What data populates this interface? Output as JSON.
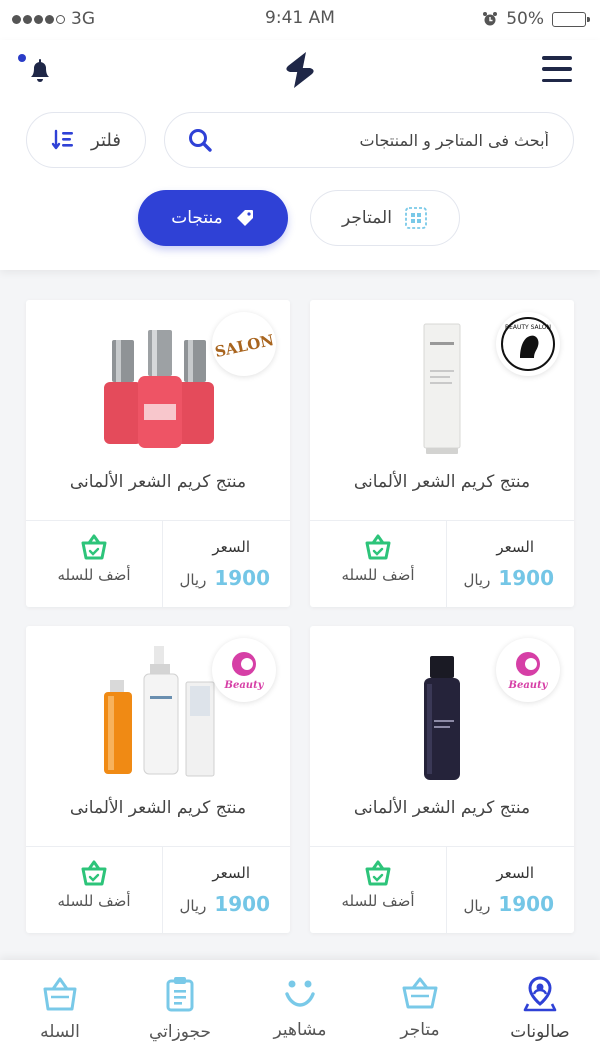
{
  "status_bar": {
    "carrier": "3G",
    "time": "9:41 AM",
    "battery": "50%",
    "battery_level": 0.5
  },
  "header": {
    "search": {
      "placeholder": "أبحث فى المتاجر و المنتجات"
    },
    "filter_label": "فلتر",
    "segments": {
      "products": "منتجات",
      "stores": "المتاجر"
    }
  },
  "colors": {
    "accent": "#2f41d6",
    "price": "#74c6e6",
    "cart_icon": "#2dc47a",
    "tab_icon": "#79c9e8"
  },
  "products": [
    {
      "name": "منتج كريم الشعر الألمانى",
      "price_label": "السعر",
      "price": "1900",
      "currency": "ريال",
      "cart_label": "أضف للسله",
      "brand": "BEAUTY SALON",
      "image": "cream-tube"
    },
    {
      "name": "منتج كريم الشعر الألمانى",
      "price_label": "السعر",
      "price": "1900",
      "currency": "ريال",
      "cart_label": "أضف للسله",
      "brand": "SALON",
      "image": "nail-polish"
    },
    {
      "name": "منتج كريم الشعر الألمانى",
      "price_label": "السعر",
      "price": "1900",
      "currency": "ريال",
      "cart_label": "أضف للسله",
      "brand": "Beauty",
      "image": "dark-bottle"
    },
    {
      "name": "منتج كريم الشعر الألمانى",
      "price_label": "السعر",
      "price": "1900",
      "currency": "ريال",
      "cart_label": "أضف للسله",
      "brand": "Beauty",
      "image": "hair-products"
    }
  ],
  "tabbar": [
    {
      "label": "صالونات",
      "icon": "location-pin-icon"
    },
    {
      "label": "متاجر",
      "icon": "basket-icon"
    },
    {
      "label": "مشاهير",
      "icon": "smile-icon"
    },
    {
      "label": "حجوزاتي",
      "icon": "clipboard-icon"
    },
    {
      "label": "السله",
      "icon": "shopping-bag-icon"
    }
  ]
}
